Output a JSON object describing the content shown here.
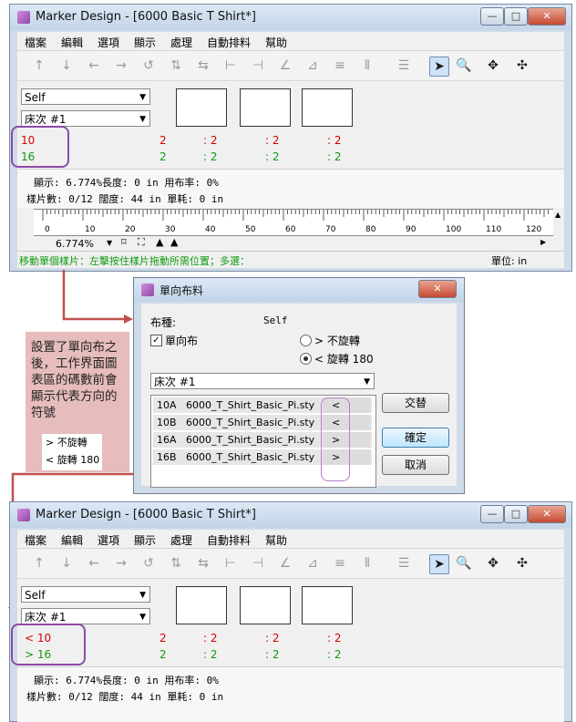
{
  "windows": [
    {
      "title": "Marker Design - [6000 Basic T Shirt*]",
      "menu": [
        "檔案",
        "編輯",
        "選項",
        "顯示",
        "處理",
        "自動排料",
        "幫助"
      ],
      "fabric_select": "Self",
      "bed_select": "床次 #1",
      "row1": {
        "label": "10",
        "cells": [
          "2",
          ": 2",
          ": 2",
          ": 2"
        ]
      },
      "row2": {
        "label": "16",
        "cells": [
          "2",
          ": 2",
          ": 2",
          ": 2"
        ]
      },
      "info_line1": "顯示:  6.774%長度:  0 in 用布率:  0%",
      "info_line2": "樣片數:  0/12  闊度:  44 in  單耗:  0 in",
      "ruler_ticks": [
        "0",
        "10",
        "20",
        "30",
        "40",
        "50",
        "60",
        "70",
        "80",
        "90",
        "100",
        "110",
        "120"
      ],
      "zoom": "6.774%",
      "status_left": "移動單個樣片：左擊按住樣片拖動所需位置；多選：",
      "status_right": "單位: in"
    },
    {
      "title": "Marker Design - [6000 Basic T Shirt*]",
      "menu": [
        "檔案",
        "編輯",
        "選項",
        "顯示",
        "處理",
        "自動排料",
        "幫助"
      ],
      "fabric_select": "Self",
      "bed_select": "床次 #1",
      "row1": {
        "label": "< 10",
        "cells": [
          "2",
          ": 2",
          ": 2",
          ": 2"
        ]
      },
      "row2": {
        "label": "> 16",
        "cells": [
          "2",
          ": 2",
          ": 2",
          ": 2"
        ]
      },
      "info_line1": "顯示:  6.774%長度:  0 in 用布率:  0%",
      "info_line2": "樣片數:  0/12  闊度:  44 in  單耗:  0 in"
    }
  ],
  "dialog": {
    "title": "單向布料",
    "fabric_label": "布種:",
    "fabric_value": "Self",
    "one_way_label": "單向布",
    "one_way_checked": "✓",
    "radio_no_rotate": "> 不旋轉",
    "radio_rotate": "< 旋轉 180",
    "bed_select": "床次 #1",
    "rows": [
      {
        "size": "10A",
        "file": "6000_T_Shirt_Basic_Pi.sty",
        "dir": "<"
      },
      {
        "size": "10B",
        "file": "6000_T_Shirt_Basic_Pi.sty",
        "dir": "<"
      },
      {
        "size": "16A",
        "file": "6000_T_Shirt_Basic_Pi.sty",
        "dir": ">"
      },
      {
        "size": "16B",
        "file": "6000_T_Shirt_Basic_Pi.sty",
        "dir": ">"
      }
    ],
    "btn_swap": "交替",
    "btn_ok": "確定",
    "btn_cancel": "取消"
  },
  "note": {
    "text": "設置了單向布之後，工作界面圖表區的碼數前會顯示代表方向的符號",
    "legend1": "> 不旋轉",
    "legend2": "< 旋轉 180"
  },
  "colors": {
    "accent_purple": "#8d4aa6",
    "arrow": "#c0504d",
    "size_red": "#d40000",
    "size_green": "#119a11"
  }
}
